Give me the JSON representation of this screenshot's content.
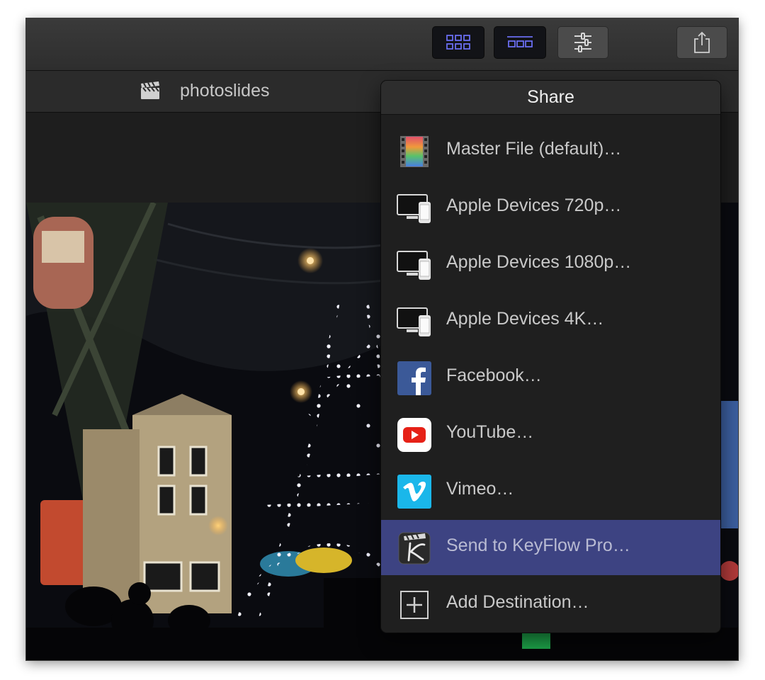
{
  "toolbar": {
    "buttons": [
      {
        "name": "grid-view",
        "icon": "grid-icon"
      },
      {
        "name": "filmstrip-view",
        "icon": "filmstrip-icon"
      },
      {
        "name": "adjustments",
        "icon": "sliders-icon"
      },
      {
        "name": "share",
        "icon": "share-icon"
      }
    ]
  },
  "browser": {
    "project_name": "photoslides",
    "icon": "clapperboard-icon"
  },
  "share_menu": {
    "title": "Share",
    "items": [
      {
        "label": "Master File (default)…",
        "icon": "master-file-icon"
      },
      {
        "label": "Apple Devices 720p…",
        "icon": "apple-devices-icon"
      },
      {
        "label": "Apple Devices 1080p…",
        "icon": "apple-devices-icon"
      },
      {
        "label": "Apple Devices 4K…",
        "icon": "apple-devices-icon"
      },
      {
        "label": "Facebook…",
        "icon": "facebook-icon"
      },
      {
        "label": "YouTube…",
        "icon": "youtube-icon"
      },
      {
        "label": "Vimeo…",
        "icon": "vimeo-icon"
      },
      {
        "label": "Send to KeyFlow Pro…",
        "icon": "keyflow-icon",
        "selected": true
      },
      {
        "label": "Add Destination…",
        "icon": "add-icon"
      }
    ]
  },
  "colors": {
    "accent": "#5b5ee6",
    "selection": "#3d4382",
    "facebook": "#3b5998",
    "youtube": "#e62117",
    "vimeo": "#1ab7ea"
  }
}
